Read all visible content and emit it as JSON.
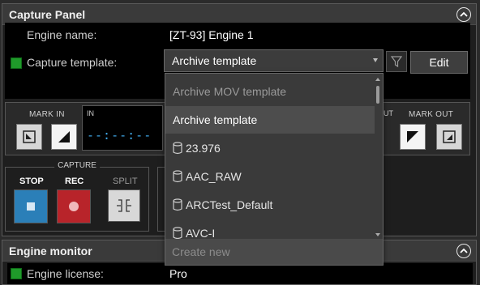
{
  "capture_panel": {
    "title": "Capture Panel",
    "engine_name_label": "Engine name:",
    "engine_name_value": "[ZT-93] Engine 1",
    "capture_template_label": "Capture template:",
    "capture_template_value": "Archive template",
    "edit_label": "Edit",
    "mark_in_label": "MARK IN",
    "mark_out_label": "MARK OUT",
    "in_label": "IN",
    "out_label": "UT",
    "timecode_in": "--:--:--",
    "capture_group_title": "CAPTURE",
    "stop_label": "STOP",
    "rec_label": "REC",
    "split_label": "SPLIT"
  },
  "dropdown": {
    "items": [
      {
        "label": "Archive MOV template",
        "icon": "none"
      },
      {
        "label": "Archive template",
        "icon": "none"
      },
      {
        "label": "23.976",
        "icon": "database-icon"
      },
      {
        "label": "AAC_RAW",
        "icon": "database-icon"
      },
      {
        "label": "ARCTest_Default",
        "icon": "database-icon"
      },
      {
        "label": "AVC-I",
        "icon": "database-icon"
      }
    ],
    "create_new_label": "Create new"
  },
  "engine_monitor": {
    "title": "Engine monitor",
    "license_label": "Engine license:",
    "license_value": "Pro"
  },
  "colors": {
    "status_green": "#1f9a2a",
    "stop_blue": "#2b7fb8",
    "rec_red": "#b8242a",
    "timecode_blue": "#3fa8e8"
  }
}
